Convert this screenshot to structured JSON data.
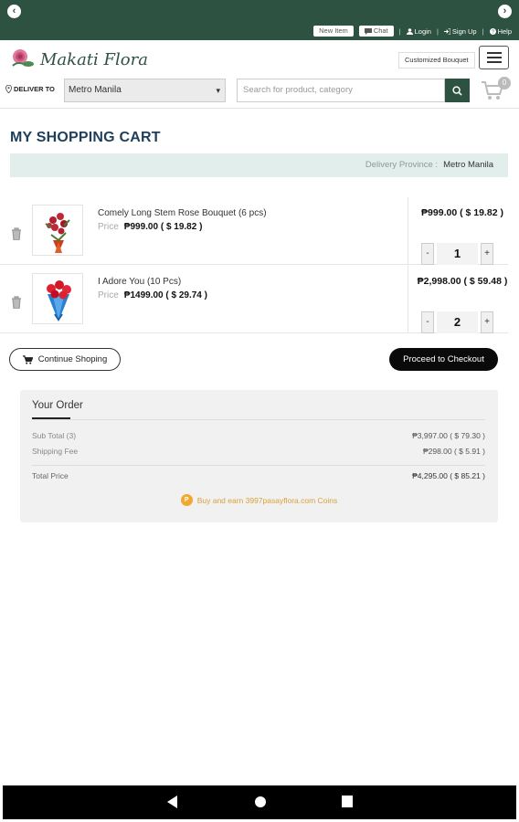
{
  "topbar": {
    "new_item": "New Item",
    "chat": "Chat",
    "login": "Login",
    "signup": "Sign Up",
    "help": "Help"
  },
  "header": {
    "logo_text": "Makati Flora",
    "customized_bouquet": "Customized Bouquet",
    "deliver_to_label": "DELIVER TO",
    "province_selected": "Metro Manila",
    "search_placeholder": "Search for product, category",
    "cart_count": "0"
  },
  "page": {
    "title": "MY SHOPPING CART",
    "delivery_province_label": "Delivery Province :",
    "delivery_province_value": "Metro Manila"
  },
  "cart_items": [
    {
      "name": "Comely Long Stem Rose Bouquet (6 pcs)",
      "price_label": "Price",
      "price": "₱999.00 ( $ 19.82 )",
      "total": "₱999.00 ( $ 19.82 )",
      "qty": "1"
    },
    {
      "name": "I Adore You (10 Pcs)",
      "price_label": "Price",
      "price": "₱1499.00 ( $ 29.74 )",
      "total": "₱2,998.00 ( $ 59.48 )",
      "qty": "2"
    }
  ],
  "qty_controls": {
    "minus": "-",
    "plus": "+"
  },
  "actions": {
    "continue": "Continue Shoping",
    "checkout": "Proceed to Checkout"
  },
  "order": {
    "heading": "Your Order",
    "subtotal_label": "Sub Total (3)",
    "subtotal_value": "₱3,997.00 ( $ 79.30 )",
    "shipping_label": "Shipping Fee",
    "shipping_value": "₱298.00 ( $ 5.91 )",
    "total_label": "Total Price",
    "total_value": "₱4,295.00 ( $ 85.21 )",
    "coins_text": "Buy and earn 3997pasayflora.com Coins",
    "coin_symbol": "P"
  },
  "colors": {
    "brand_green": "#2e5242",
    "title_blue": "#1f3e5a",
    "province_bar": "#e2eeeb",
    "coin_orange": "#f0a830"
  }
}
